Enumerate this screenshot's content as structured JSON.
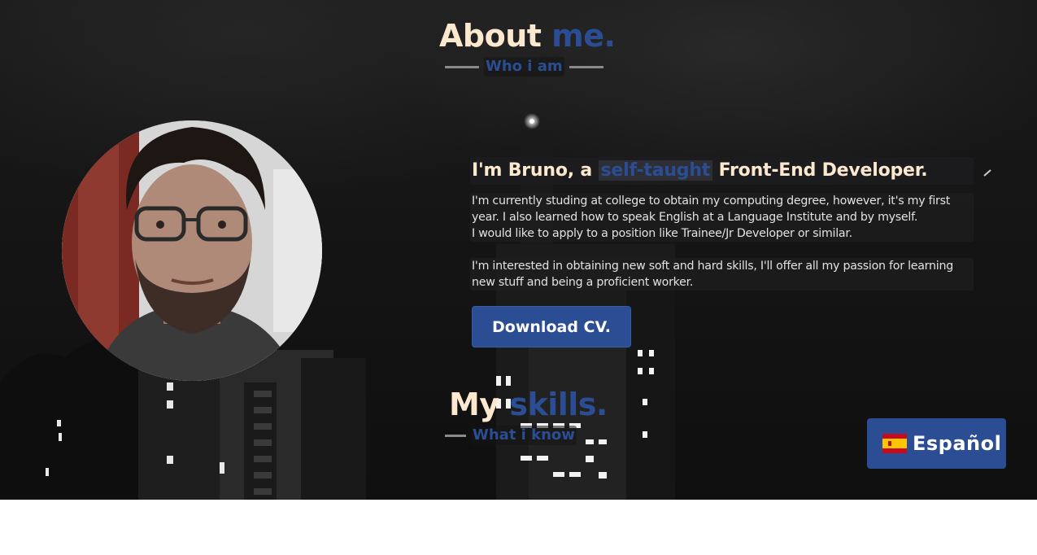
{
  "about": {
    "title_part1": "About",
    "title_part2": "me.",
    "subtitle": "Who i am"
  },
  "intro": {
    "headline_prefix": "I'm Bruno, a",
    "headline_highlight": "self-taught",
    "headline_suffix": "Front-End Developer.",
    "paragraph1_line1": "I'm currently studing at college to obtain my computing degree, however, it's my first",
    "paragraph1_line2": "year. I also learned how to speak English at a Language Institute and by myself.",
    "paragraph1_line3": "I would like to apply to a position like Trainee/Jr Developer or similar.",
    "paragraph2_line1": "I'm interested in obtaining new soft and hard skills, I'll offer all my passion for learning",
    "paragraph2_line2": "new stuff and being a proficient worker."
  },
  "download_button": {
    "label": "Download CV."
  },
  "skills": {
    "title_part1": "My",
    "title_part2": "skills.",
    "subtitle": "What i know"
  },
  "language_button": {
    "label": "Español",
    "icon": "spain-flag-icon"
  },
  "colors": {
    "accent_blue": "#2b4d93",
    "cream": "#fbe8cf",
    "background_dark": "#151515"
  }
}
